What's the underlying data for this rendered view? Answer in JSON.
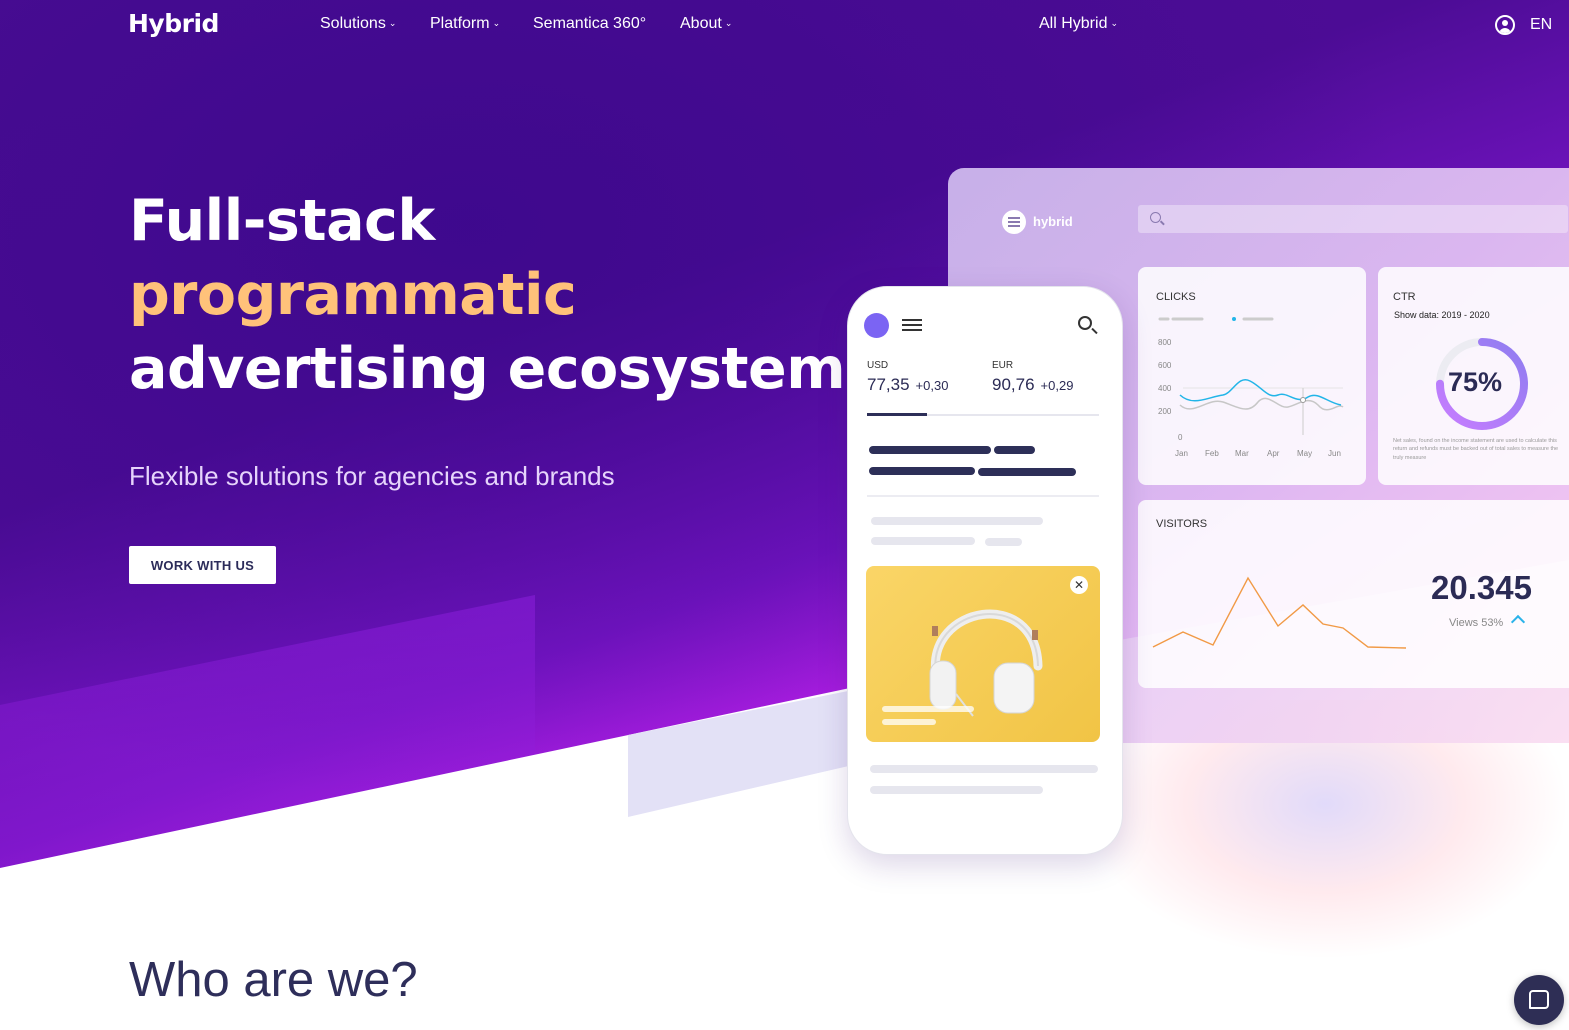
{
  "nav": {
    "logo": "Hybrid",
    "items": [
      {
        "label": "Solutions",
        "dropdown": true
      },
      {
        "label": "Platform",
        "dropdown": true
      },
      {
        "label": "Semantica 360°",
        "dropdown": false
      },
      {
        "label": "About",
        "dropdown": true
      }
    ],
    "all_hybrid": "All Hybrid",
    "lang": "EN",
    "dropdown_glyph": "⌄"
  },
  "hero": {
    "line1": "Full-stack",
    "line2": "programmatic",
    "line3": "advertising ecosystem",
    "subtitle": "Flexible solutions for agencies and brands",
    "cta": "WORK WITH US",
    "accent_color": "#ffc27a"
  },
  "dashboard": {
    "logo_text": "hybrid",
    "clicks": {
      "title": "CLICKS",
      "y_ticks": [
        "800",
        "600",
        "400",
        "200",
        "0"
      ],
      "x_ticks": [
        "Jan",
        "Feb",
        "Mar",
        "Apr",
        "May",
        "Jun"
      ]
    },
    "ctr": {
      "title": "CTR",
      "subtitle": "Show data: 2019 - 2020",
      "percent": "75%",
      "value": 0.75,
      "note": "Net sales, found on the income statement are used to calculate this return and refunds must be backed out of total sales to measure the truly measure"
    },
    "visitors": {
      "title": "VISITORS",
      "count": "20.345",
      "views": "Views 53%"
    }
  },
  "phone": {
    "usd_label": "USD",
    "usd_value": "77,35",
    "usd_change": "+0,30",
    "eur_label": "EUR",
    "eur_value": "90,76",
    "eur_change": "+0,29",
    "close_glyph": "✕"
  },
  "section": {
    "who_title": "Who are we?"
  }
}
